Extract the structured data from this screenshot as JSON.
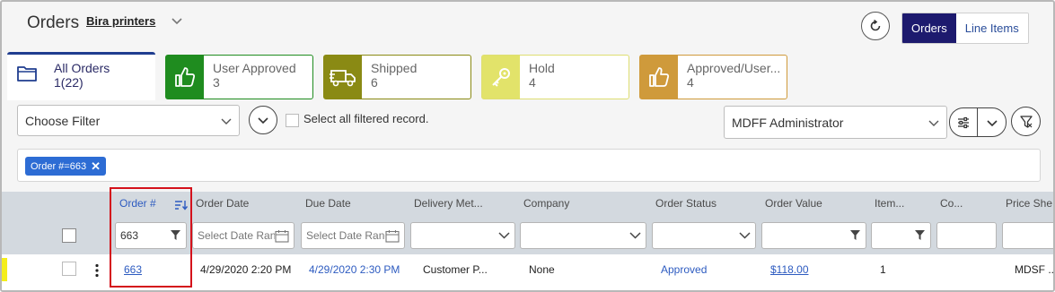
{
  "header": {
    "title": "Orders",
    "company": "Bira printers",
    "view_toggle": {
      "active": "Orders",
      "inactive": "Line Items"
    }
  },
  "tabs": [
    {
      "label": "All Orders",
      "count": "1(22)",
      "icon": "folder-icon"
    },
    {
      "label": "User Approved",
      "count": "3",
      "icon": "thumbs-up-icon",
      "color": "#1f8c1f"
    },
    {
      "label": "Shipped",
      "count": "6",
      "icon": "truck-icon",
      "color": "#8a8a14"
    },
    {
      "label": "Hold",
      "count": "4",
      "icon": "key-icon",
      "color": "#e2e36a"
    },
    {
      "label": "Approved/User...",
      "count": "4",
      "icon": "thumbs-up-icon",
      "color": "#cf9a3b"
    }
  ],
  "filters": {
    "choose_filter": "Choose Filter",
    "select_all_label": "Select all filtered record.",
    "role": "MDFF Administrator",
    "chip": "Order #=663"
  },
  "columns": [
    "Order #",
    "Order Date",
    "Due Date",
    "Delivery Met...",
    "Company",
    "Order Status",
    "Order Value",
    "Item...",
    "Co...",
    "Price She..."
  ],
  "column_filters": {
    "order_no": "663",
    "order_date_placeholder": "Select Date Range",
    "due_date_placeholder": "Select Date Range"
  },
  "rows": [
    {
      "order_no": "663",
      "order_date": "4/29/2020 2:20 PM",
      "due_date": "4/29/2020 2:30 PM",
      "delivery": "Customer P...",
      "company": "None",
      "status": "Approved",
      "value": "$118.00",
      "items": "1",
      "price_sheet": "MDSF ..."
    }
  ],
  "colors": {
    "accent": "#1d1a6e",
    "link": "#2d5bc0",
    "chip": "#2d6cd4",
    "highlight": "#d4111b"
  }
}
